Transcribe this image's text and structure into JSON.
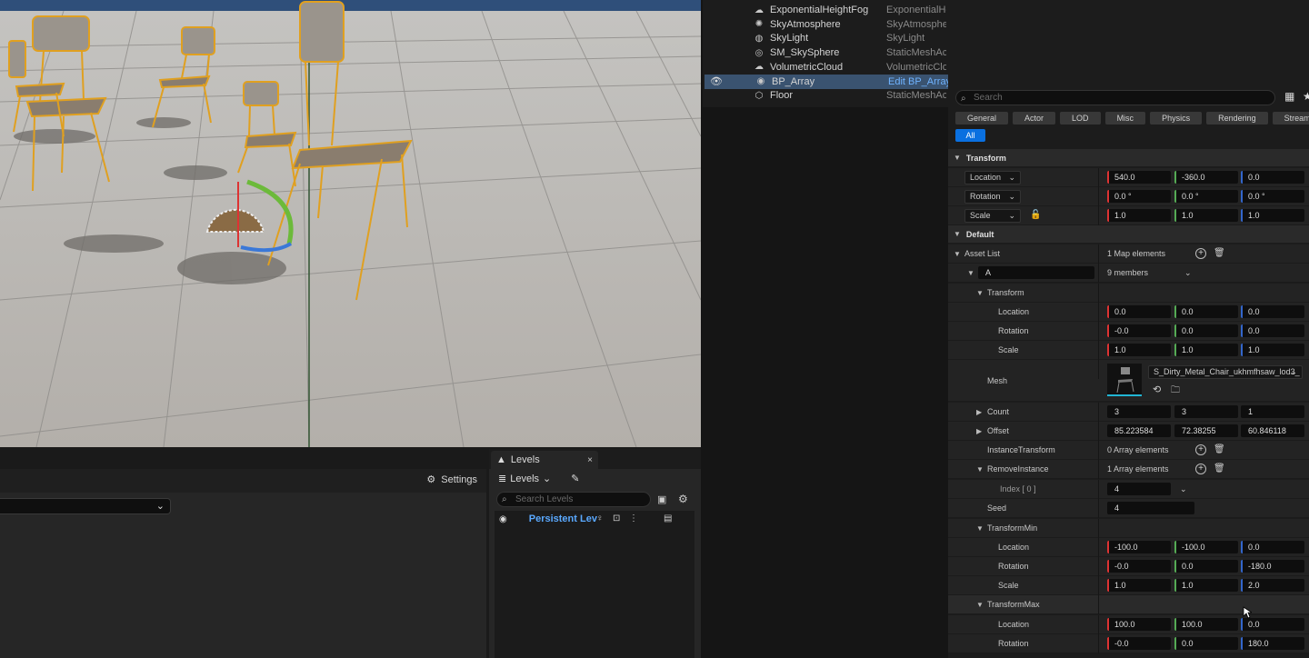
{
  "outliner": {
    "rows": [
      {
        "name": "ExponentialHeightFog",
        "type": "ExponentialHe",
        "icon": "fog-icon"
      },
      {
        "name": "SkyAtmosphere",
        "type": "SkyAtmosphe",
        "icon": "atmosphere-icon"
      },
      {
        "name": "SkyLight",
        "type": "SkyLight",
        "icon": "skylight-icon"
      },
      {
        "name": "SM_SkySphere",
        "type": "StaticMeshAc",
        "icon": "sphere-icon"
      },
      {
        "name": "VolumetricCloud",
        "type": "VolumetricClo",
        "icon": "cloud-icon"
      },
      {
        "name": "BP_Array",
        "type": "Edit BP_Array",
        "icon": "blueprint-icon",
        "selected": true
      },
      {
        "name": "Floor",
        "type": "StaticMeshAc",
        "icon": "mesh-icon"
      }
    ]
  },
  "bottom_left": {
    "settings_label": "Settings"
  },
  "levels": {
    "tab_label": "Levels",
    "close": "×",
    "dropdown_label": "Levels",
    "search_placeholder": "Search Levels",
    "level_name": "Persistent Lev"
  },
  "details": {
    "search_placeholder": "Search",
    "filters": [
      "General",
      "Actor",
      "LOD",
      "Misc",
      "Physics",
      "Rendering",
      "Streaming"
    ],
    "filter_all": "All",
    "transform_section": "Transform",
    "transform": {
      "location_label": "Location",
      "location": [
        "540.0",
        "-360.0",
        "0.0"
      ],
      "rotation_label": "Rotation",
      "rotation": [
        "0.0 °",
        "0.0 °",
        "0.0 °"
      ],
      "scale_label": "Scale",
      "scale": [
        "1.0",
        "1.0",
        "1.0"
      ]
    },
    "default_section": "Default",
    "asset_list": {
      "label": "Asset List",
      "value": "1 Map elements",
      "key": "A",
      "members": "9 members",
      "transform_label": "Transform",
      "location_label": "Location",
      "location": [
        "0.0",
        "0.0",
        "0.0"
      ],
      "rotation_label": "Rotation",
      "rotation": [
        "-0.0",
        "0.0",
        "0.0"
      ],
      "scale_label": "Scale",
      "scale": [
        "1.0",
        "1.0",
        "1.0"
      ],
      "mesh_label": "Mesh",
      "mesh_value": "S_Dirty_Metal_Chair_ukhmfhsaw_lod3_",
      "count_label": "Count",
      "count": [
        "3",
        "3",
        "1"
      ],
      "offset_label": "Offset",
      "offset": [
        "85.223584",
        "72.38255",
        "60.846118"
      ],
      "instance_transform_label": "InstanceTransform",
      "instance_transform_value": "0 Array elements",
      "remove_instance_label": "RemoveInstance",
      "remove_instance_value": "1 Array elements",
      "index_label": "Index [ 0 ]",
      "index_value": "4",
      "seed_label": "Seed",
      "seed_value": "4",
      "tmin_label": "TransformMin",
      "tmin_location_label": "Location",
      "tmin_location": [
        "-100.0",
        "-100.0",
        "0.0"
      ],
      "tmin_rotation_label": "Rotation",
      "tmin_rotation": [
        "-0.0",
        "0.0",
        "-180.0"
      ],
      "tmin_scale_label": "Scale",
      "tmin_scale": [
        "1.0",
        "1.0",
        "2.0"
      ],
      "tmax_label": "TransformMax",
      "tmax_location_label": "Location",
      "tmax_location": [
        "100.0",
        "100.0",
        "0.0"
      ],
      "tmax_rotation_label": "Rotation",
      "tmax_rotation": [
        "-0.0",
        "0.0",
        "180.0"
      ]
    }
  },
  "colors": {
    "selection": "#3a5370",
    "accent": "#0a70e0",
    "gizmo_x": "#d33",
    "gizmo_y": "#5a5",
    "gizmo_z": "#36c"
  }
}
